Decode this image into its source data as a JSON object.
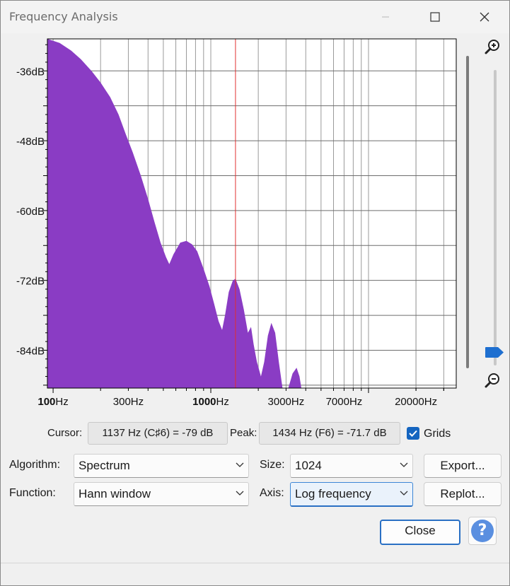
{
  "window": {
    "title": "Frequency Analysis"
  },
  "chart_data": {
    "type": "area",
    "x_scale": "log",
    "xlim": [
      92,
      36000
    ],
    "ylim": [
      -90.5,
      -30.5
    ],
    "x_ticks": [
      {
        "value": 100,
        "label": "100Hz"
      },
      {
        "value": 300,
        "label": "300Hz"
      },
      {
        "value": 1000,
        "label": "1000Hz"
      },
      {
        "value": 3000,
        "label": "3000Hz"
      },
      {
        "value": 7000,
        "label": "7000Hz"
      },
      {
        "value": 20000,
        "label": "20000Hz"
      }
    ],
    "y_ticks": [
      {
        "value": -36,
        "label": "-36dB"
      },
      {
        "value": -48,
        "label": "-48dB"
      },
      {
        "value": -60,
        "label": "-60dB"
      },
      {
        "value": -72,
        "label": "-72dB"
      },
      {
        "value": -84,
        "label": "-84dB"
      }
    ],
    "grid": true,
    "cursor_hz": 1434,
    "series": [
      {
        "color": "#8a3cc4",
        "points": [
          [
            92,
            -30.2
          ],
          [
            110,
            -31.2
          ],
          [
            130,
            -32.5
          ],
          [
            150,
            -34.0
          ],
          [
            175,
            -36.0
          ],
          [
            200,
            -38.0
          ],
          [
            230,
            -40.5
          ],
          [
            260,
            -43.5
          ],
          [
            290,
            -47.0
          ],
          [
            320,
            -50.0
          ],
          [
            360,
            -54.0
          ],
          [
            400,
            -58.0
          ],
          [
            440,
            -62.0
          ],
          [
            480,
            -65.5
          ],
          [
            520,
            -68.0
          ],
          [
            545,
            -69.2
          ],
          [
            580,
            -67.5
          ],
          [
            640,
            -65.5
          ],
          [
            700,
            -65.2
          ],
          [
            760,
            -65.8
          ],
          [
            820,
            -67.0
          ],
          [
            900,
            -70.0
          ],
          [
            980,
            -73.0
          ],
          [
            1050,
            -76.0
          ],
          [
            1120,
            -79.0
          ],
          [
            1180,
            -80.5
          ],
          [
            1230,
            -78.0
          ],
          [
            1300,
            -74.0
          ],
          [
            1380,
            -72.0
          ],
          [
            1434,
            -71.7
          ],
          [
            1520,
            -73.5
          ],
          [
            1620,
            -77.0
          ],
          [
            1720,
            -81.0
          ],
          [
            1800,
            -80.0
          ],
          [
            1870,
            -83.0
          ],
          [
            1960,
            -86.0
          ],
          [
            2080,
            -88.5
          ],
          [
            2180,
            -86.0
          ],
          [
            2300,
            -81.5
          ],
          [
            2420,
            -79.3
          ],
          [
            2560,
            -81.0
          ],
          [
            2700,
            -86.0
          ],
          [
            2850,
            -90.5
          ],
          [
            3100,
            -90.5
          ],
          [
            3300,
            -88.0
          ],
          [
            3500,
            -87.0
          ],
          [
            3650,
            -88.5
          ],
          [
            3750,
            -90.5
          ],
          [
            36000,
            -90.5
          ]
        ]
      }
    ]
  },
  "controls": {
    "cursor_label": "Cursor:",
    "cursor_value": "1137 Hz (C♯6) = -79 dB",
    "peak_label": "Peak:",
    "peak_value": "1434 Hz (F6) = -71.7 dB",
    "grids_label": "Grids",
    "grids_checked": true,
    "algorithm_label": "Algorithm:",
    "algorithm_value": "Spectrum",
    "function_label": "Function:",
    "function_value": "Hann window",
    "size_label": "Size:",
    "size_value": "1024",
    "axis_label": "Axis:",
    "axis_value": "Log frequency",
    "export_label": "Export...",
    "replot_label": "Replot...",
    "close_label": "Close",
    "help_label": "?"
  }
}
